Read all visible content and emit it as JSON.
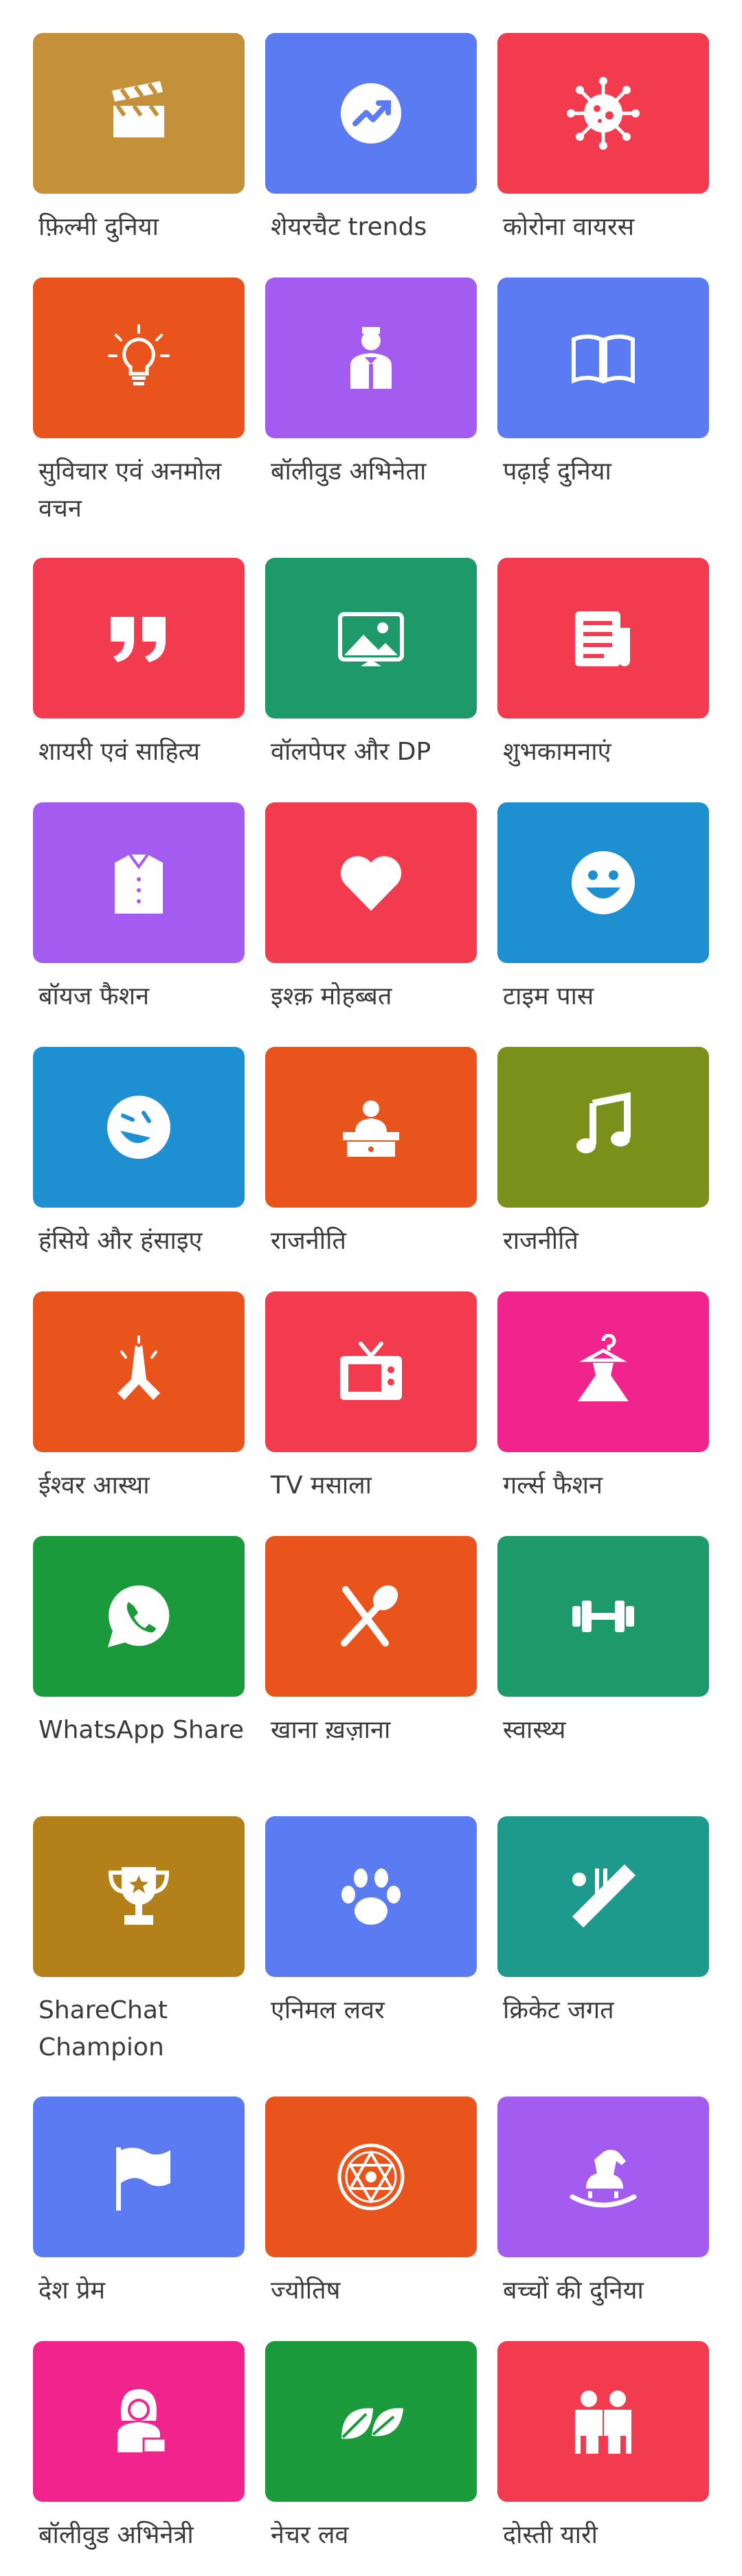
{
  "colors": {
    "gold": "#C4913A",
    "blue": "#5A7BF2",
    "red": "#F23B4E",
    "orange": "#E8541C",
    "purple": "#A35BF0",
    "green": "#1E9A6A",
    "sky": "#1E8FD0",
    "olive": "#7A901A",
    "pink": "#F0248C",
    "wagreen": "#1A9A3A",
    "ochre": "#B3801A",
    "teal": "#1E9A8C"
  },
  "tiles": [
    {
      "label": "फ़िल्मी दुनिया",
      "icon": "clapperboard-icon",
      "color": "#C4913A"
    },
    {
      "label": "शेयरचैट trends",
      "icon": "trending-arrow-icon",
      "color": "#5A7BF2"
    },
    {
      "label": "कोरोना वायरस",
      "icon": "virus-icon",
      "color": "#F23B4E"
    },
    {
      "label": "सुविचार एवं अनमोल वचन",
      "icon": "lightbulb-icon",
      "color": "#E8541C"
    },
    {
      "label": "बॉलीवुड अभिनेता",
      "icon": "actor-icon",
      "color": "#A35BF0"
    },
    {
      "label": "पढ़ाई दुनिया",
      "icon": "book-icon",
      "color": "#5A7BF2"
    },
    {
      "label": "शायरी एवं साहित्य",
      "icon": "quote-icon",
      "color": "#F23B4E"
    },
    {
      "label": "वॉलपेपर और DP",
      "icon": "picture-icon",
      "color": "#1E9A6A"
    },
    {
      "label": "शुभकामनाएं",
      "icon": "news-icon",
      "color": "#F23B4E"
    },
    {
      "label": "बॉयज फैशन",
      "icon": "shirt-icon",
      "color": "#A35BF0"
    },
    {
      "label": "इश्क़ मोहब्बत",
      "icon": "heart-icon",
      "color": "#F23B4E"
    },
    {
      "label": "टाइम पास",
      "icon": "smiley-icon",
      "color": "#1E8FD0"
    },
    {
      "label": "हंसिये और हंसाइए",
      "icon": "laughing-icon",
      "color": "#1E8FD0"
    },
    {
      "label": "राजनीति",
      "icon": "politician-icon",
      "color": "#E8541C"
    },
    {
      "label": "राजनीति",
      "icon": "music-note-icon",
      "color": "#7A901A"
    },
    {
      "label": "ईश्वर आस्था",
      "icon": "praying-hands-icon",
      "color": "#E8541C"
    },
    {
      "label": "TV मसाला",
      "icon": "tv-icon",
      "color": "#F23B4E"
    },
    {
      "label": "गर्ल्स फैशन",
      "icon": "dress-icon",
      "color": "#F0248C"
    },
    {
      "label": "WhatsApp Share",
      "icon": "whatsapp-icon",
      "color": "#1A9A3A"
    },
    {
      "label": "खाना ख़ज़ाना",
      "icon": "fork-spoon-icon",
      "color": "#E8541C"
    },
    {
      "label": "स्वास्थ्य",
      "icon": "dumbbell-icon",
      "color": "#1E9A6A"
    },
    {
      "label": "ShareChat Champion",
      "icon": "trophy-icon",
      "color": "#B3801A"
    },
    {
      "label": "एनिमल लवर",
      "icon": "paw-icon",
      "color": "#5A7BF2"
    },
    {
      "label": "क्रिकेट जगत",
      "icon": "cricket-icon",
      "color": "#1E9A8C"
    },
    {
      "label": "देश प्रेम",
      "icon": "flag-icon",
      "color": "#5A7BF2"
    },
    {
      "label": "ज्योतिष",
      "icon": "astrology-icon",
      "color": "#E8541C"
    },
    {
      "label": "बच्चों की दुनिया",
      "icon": "rocking-horse-icon",
      "color": "#A35BF0"
    },
    {
      "label": "बॉलीवुड अभिनेत्री",
      "icon": "actress-icon",
      "color": "#F0248C"
    },
    {
      "label": "नेचर लव",
      "icon": "leaves-icon",
      "color": "#1A9A3A"
    },
    {
      "label": "दोस्ती यारी",
      "icon": "friends-icon",
      "color": "#F23B4E"
    }
  ]
}
